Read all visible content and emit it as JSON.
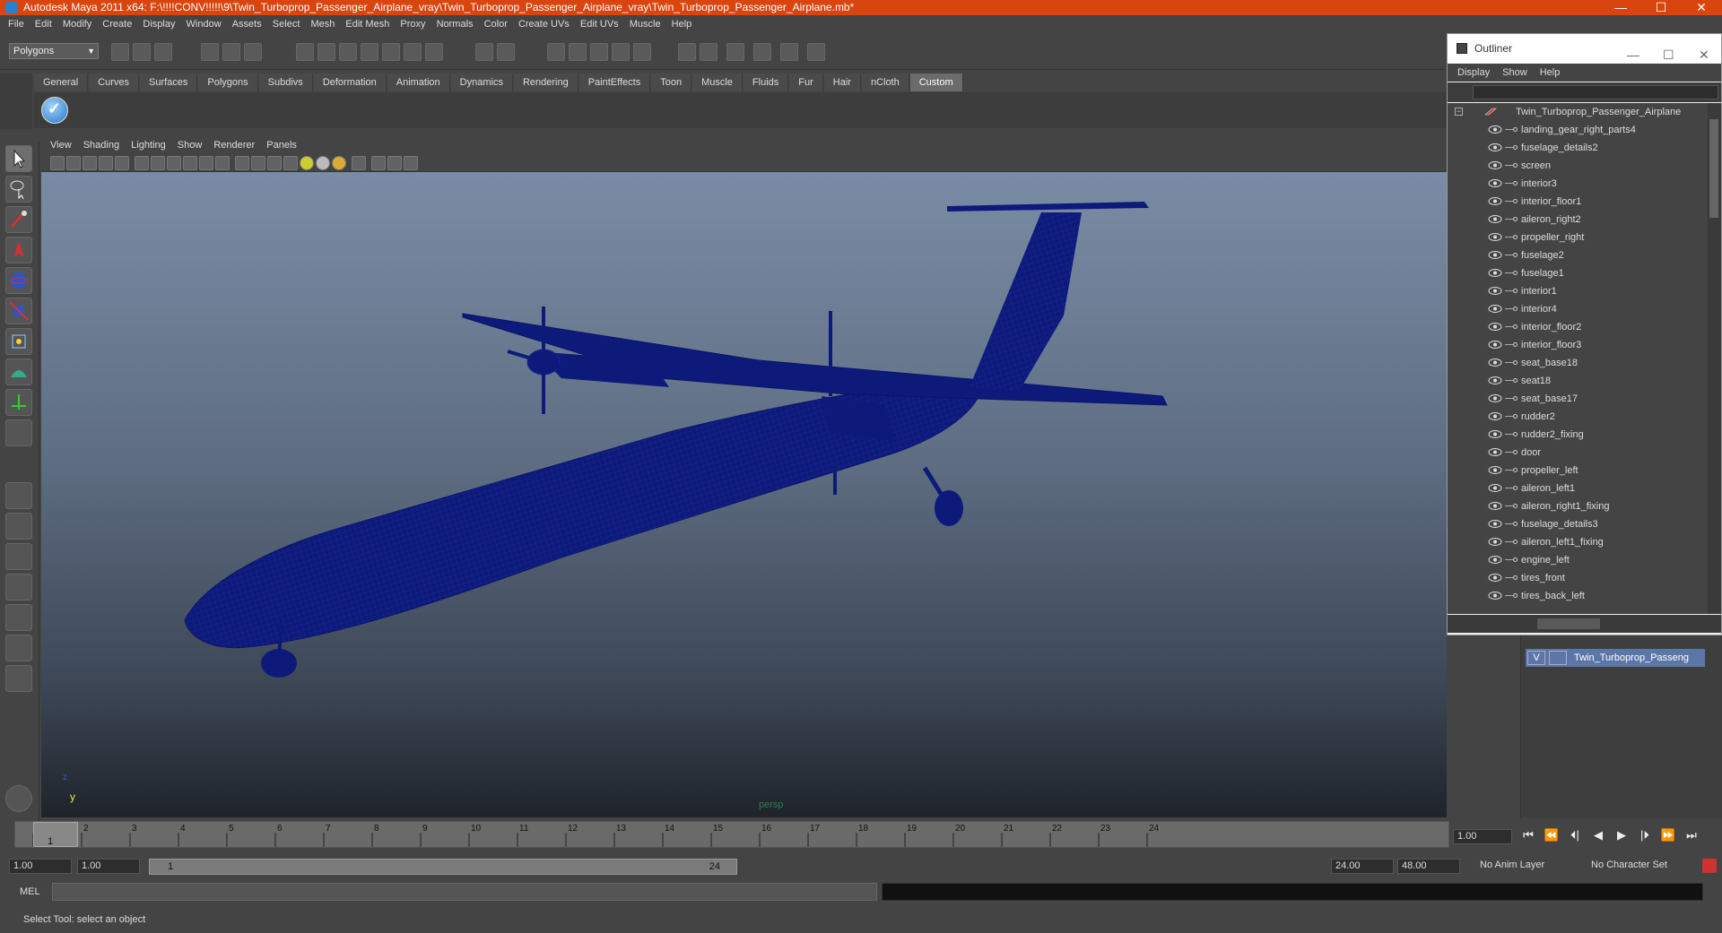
{
  "titlebar": {
    "title": "Autodesk Maya 2011 x64: F:\\!!!!CONV!!!!!\\9\\Twin_Turboprop_Passenger_Airplane_vray\\Twin_Turboprop_Passenger_Airplane_vray\\Twin_Turboprop_Passenger_Airplane.mb*",
    "minimize": "—",
    "maximize": "☐",
    "close": "✕"
  },
  "menubar": [
    "File",
    "Edit",
    "Modify",
    "Create",
    "Display",
    "Window",
    "Assets",
    "Select",
    "Mesh",
    "Edit Mesh",
    "Proxy",
    "Normals",
    "Color",
    "Create UVs",
    "Edit UVs",
    "Muscle",
    "Help"
  ],
  "mode_selector": "Polygons",
  "shelf_tabs": [
    "General",
    "Curves",
    "Surfaces",
    "Polygons",
    "Subdivs",
    "Deformation",
    "Animation",
    "Dynamics",
    "Rendering",
    "PaintEffects",
    "Toon",
    "Muscle",
    "Fluids",
    "Fur",
    "Hair",
    "nCloth",
    "Custom"
  ],
  "active_shelf_tab": "Custom",
  "panel_menu": [
    "View",
    "Shading",
    "Lighting",
    "Show",
    "Renderer",
    "Panels"
  ],
  "viewport": {
    "camera": "persp",
    "axis_y": "y",
    "axis_z": "z"
  },
  "outliner": {
    "title": "Outliner",
    "menu": [
      "Display",
      "Show",
      "Help"
    ],
    "root": "Twin_Turboprop_Passenger_Airplane",
    "items": [
      "landing_gear_right_parts4",
      "fuselage_details2",
      "screen",
      "interior3",
      "interior_floor1",
      "aileron_right2",
      "propeller_right",
      "fuselage2",
      "fuselage1",
      "interior1",
      "interior4",
      "interior_floor2",
      "interior_floor3",
      "seat_base18",
      "seat18",
      "seat_base17",
      "rudder2",
      "rudder2_fixing",
      "door",
      "propeller_left",
      "aileron_left1",
      "aileron_right1_fixing",
      "fuselage_details3",
      "aileron_left1_fixing",
      "engine_left",
      "tires_front",
      "tires_back_left"
    ]
  },
  "layer": {
    "visible": "V",
    "name": "Twin_Turboprop_Passeng"
  },
  "timeline": {
    "frames": [
      "1",
      "2",
      "3",
      "4",
      "5",
      "6",
      "7",
      "8",
      "9",
      "10",
      "11",
      "12",
      "13",
      "14",
      "15",
      "16",
      "17",
      "18",
      "19",
      "20",
      "21",
      "22",
      "23",
      "24"
    ],
    "current": "1",
    "current_time_field": "1.00"
  },
  "playback": {
    "buttons": [
      "⏮",
      "⏪",
      "⏴|",
      "◀",
      "▶",
      "|⏵",
      "⏩",
      "⏭"
    ]
  },
  "range": {
    "start": "1.00",
    "start2": "1.00",
    "range_start": "1",
    "range_end": "24",
    "end": "24.00",
    "end2": "48.00",
    "anim_layer": "No Anim Layer",
    "character_set": "No Character Set"
  },
  "command_line": {
    "label": "MEL"
  },
  "help_line": "Select Tool: select an object",
  "colors": {
    "title_bg": "#d9440f",
    "wire": "#0d1a7a",
    "layer_bg": "#5d76a8"
  }
}
